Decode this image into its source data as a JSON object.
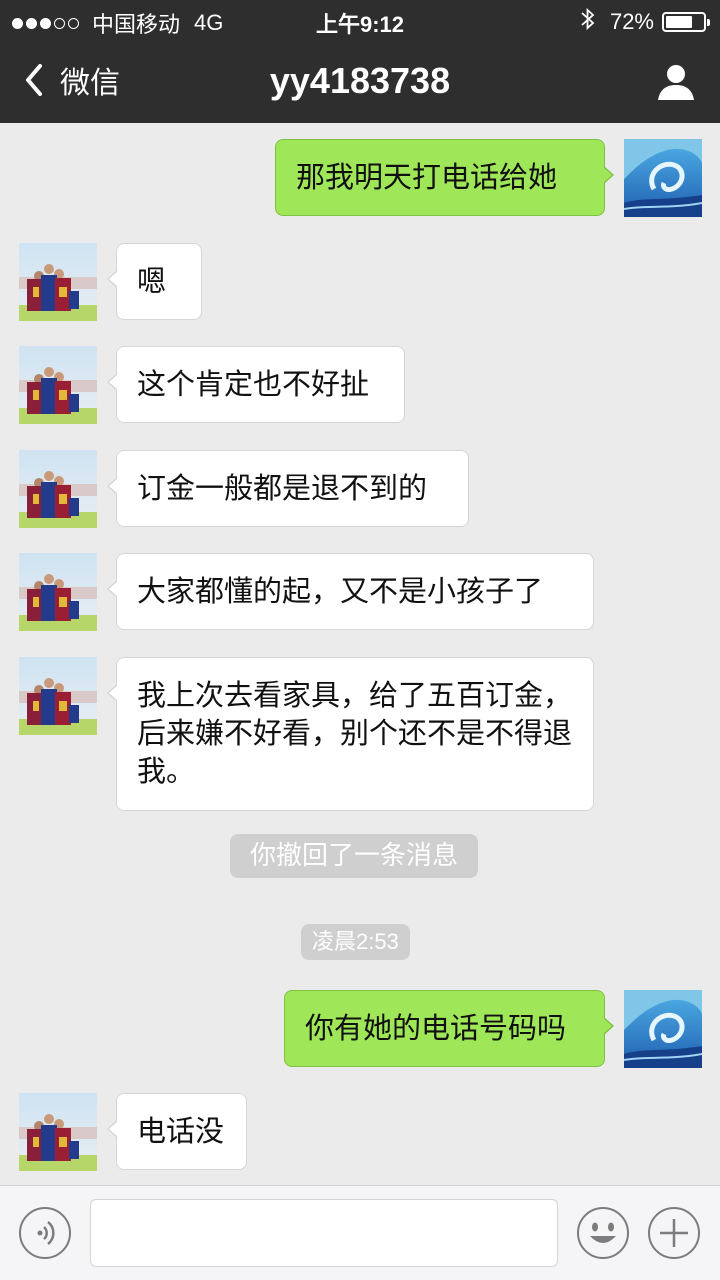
{
  "status_bar": {
    "signal_dots_filled": 3,
    "signal_dots_total": 5,
    "carrier": "中国移动",
    "network": "4G",
    "time": "上午9:12",
    "bluetooth_icon": "bluetooth-icon",
    "battery_percent": "72%",
    "battery_level": 0.72
  },
  "nav": {
    "back_label": "微信",
    "title": "yy4183738",
    "profile_icon": "person-icon"
  },
  "messages": [
    {
      "side": "out",
      "text": "那我明天打电话给她"
    },
    {
      "side": "in",
      "text": "嗯"
    },
    {
      "side": "in",
      "text": "这个肯定也不好扯"
    },
    {
      "side": "in",
      "text": "订金一般都是退不到的"
    },
    {
      "side": "in",
      "text": "大家都懂的起，又不是小孩子了"
    },
    {
      "side": "in",
      "text": "我上次去看家具，给了五百订金，后来嫌不好看，别个还不是不得退我。"
    },
    {
      "side": "system",
      "text": "你撤回了一条消息"
    },
    {
      "side": "time",
      "text": "凌晨2:53"
    },
    {
      "side": "out",
      "text": "你有她的电话号码吗"
    },
    {
      "side": "in",
      "text": "电话没"
    }
  ],
  "input_bar": {
    "voice_icon": "voice-icon",
    "input_value": "",
    "emoji_icon": "emoji-icon",
    "plus_icon": "plus-icon"
  },
  "colors": {
    "nav_bg": "#2e2e2e",
    "chat_bg": "#ebebeb",
    "outgoing_bubble": "#9fe658",
    "incoming_bubble": "#ffffff",
    "system_notice_bg": "#cfcfcf"
  }
}
